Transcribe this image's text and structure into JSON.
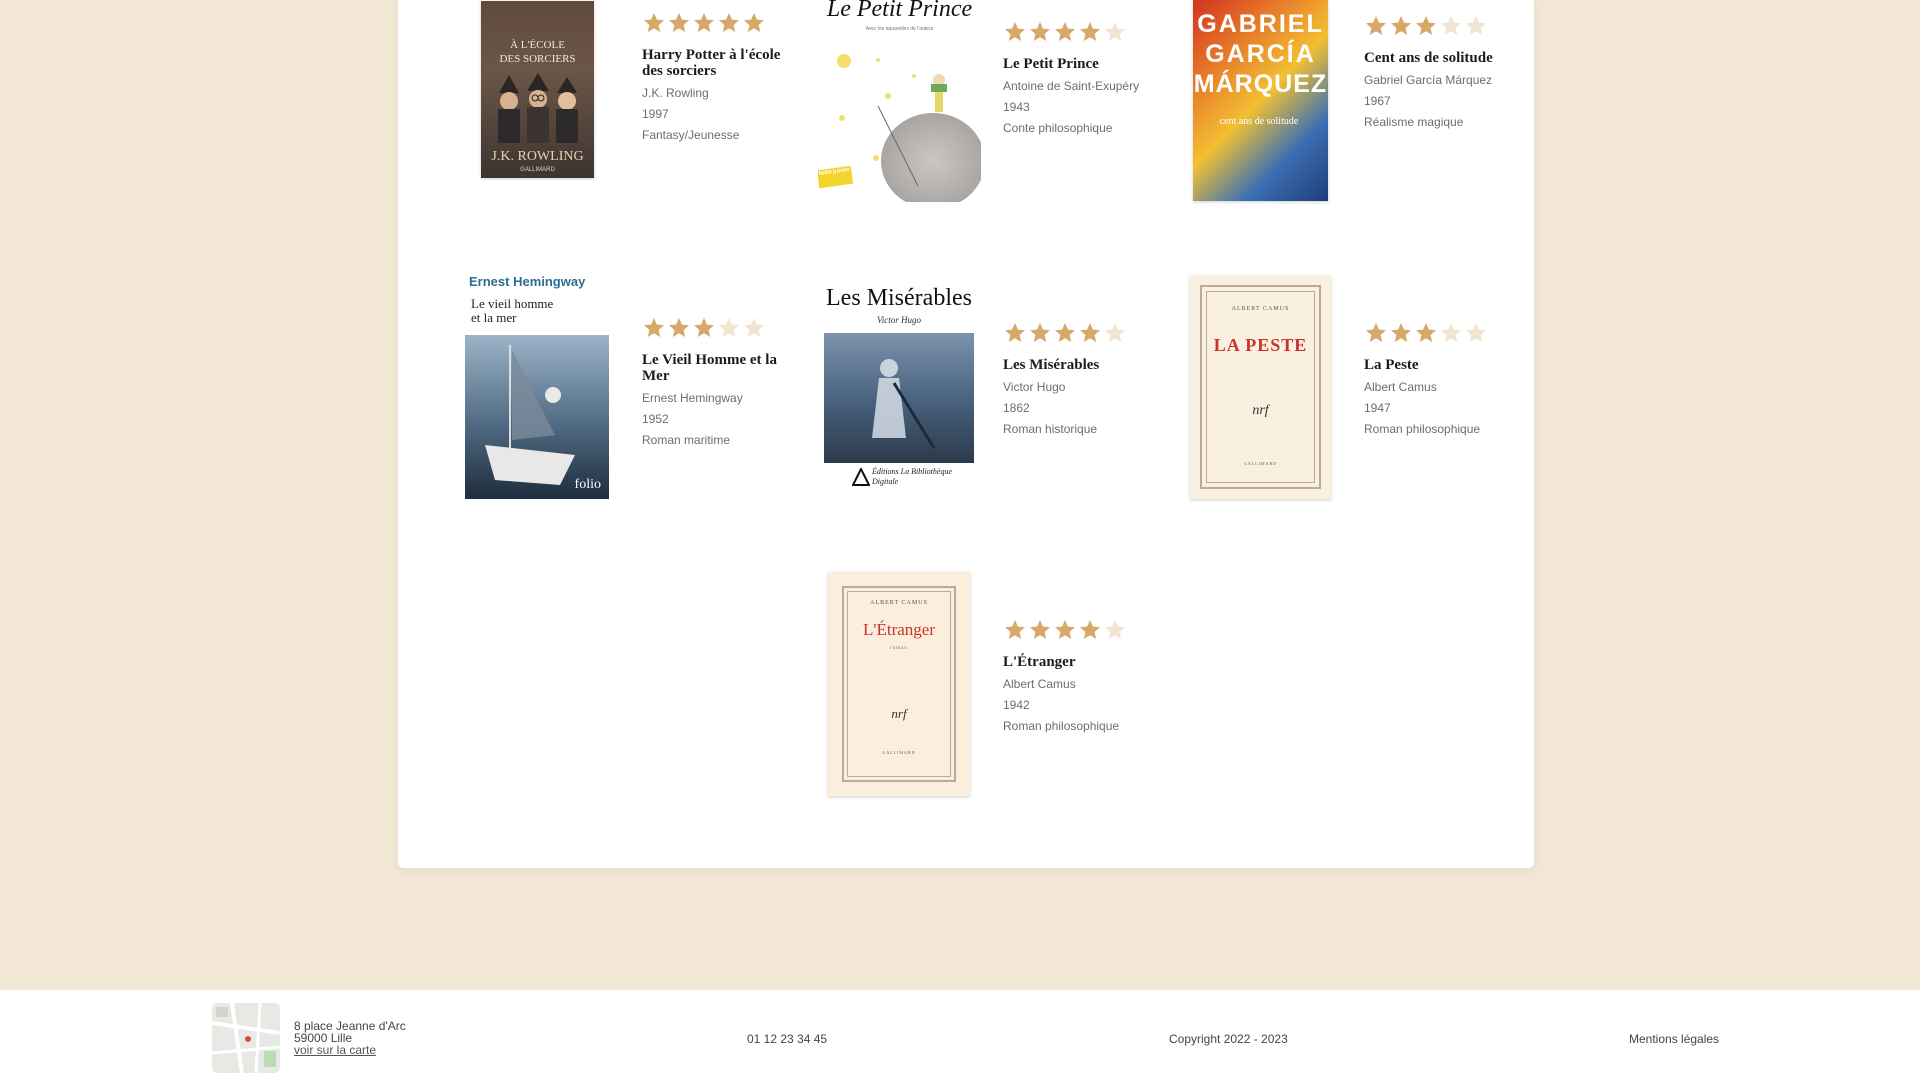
{
  "colors": {
    "star_filled": "#d8a868",
    "star_empty": "#f1e4d0",
    "background": "#f2e6d5"
  },
  "books": [
    {
      "title": "Harry Potter à l'école des sorciers",
      "author": "J.K. Rowling",
      "year": "1997",
      "genre": "Fantasy/Jeunesse",
      "rating": 5,
      "cover": {
        "line1": "À L'ÉCOLE",
        "line2": "DES SORCIERS",
        "author": "J.K. ROWLING",
        "publisher": "GALLIMARD"
      }
    },
    {
      "title": "Le Petit Prince",
      "author": "Antoine de Saint-Exupéry",
      "year": "1943",
      "genre": "Conte philosophique",
      "rating": 4,
      "cover": {
        "line1": "Le Petit Prince",
        "sub": "Avec les aquarelles de l'auteur",
        "badge": "folio junior"
      }
    },
    {
      "title": "Cent ans de solitude",
      "author": "Gabriel García Márquez",
      "year": "1967",
      "genre": "Réalisme magique",
      "rating": 3,
      "cover": {
        "line1": "GABRIEL",
        "line2": "GARCÍA",
        "line3": "MÁRQUEZ",
        "sub": "cent ans de solitude"
      }
    },
    {
      "title": "Le Vieil Homme et la Mer",
      "author": "Ernest Hemingway",
      "year": "1952",
      "genre": "Roman maritime",
      "rating": 3,
      "cover": {
        "author": "Ernest Hemingway",
        "line1": "Le vieil homme",
        "line2": "et la mer",
        "publisher": "folio"
      }
    },
    {
      "title": "Les Misérables",
      "author": "Victor Hugo",
      "year": "1862",
      "genre": "Roman historique",
      "rating": 4,
      "cover": {
        "line1": "Les Misérables",
        "author": "Victor Hugo",
        "publisher": "Éditions La Bibliothèque Digitale"
      }
    },
    {
      "title": "La Peste",
      "author": "Albert Camus",
      "year": "1947",
      "genre": "Roman philosophique",
      "rating": 3,
      "cover": {
        "author": "ALBERT CAMUS",
        "line1": "LA PESTE",
        "logo": "nrf",
        "publisher": "GALLIMARD"
      }
    },
    {
      "title": "L'Étranger",
      "author": "Albert Camus",
      "year": "1942",
      "genre": "Roman philosophique",
      "rating": 4,
      "cover": {
        "author": "ALBERT CAMUS",
        "line1": "L'Étranger",
        "sub": "roman",
        "logo": "nrf",
        "publisher": "GALLIMARD"
      }
    }
  ],
  "footer": {
    "address_line1": "8 place Jeanne d'Arc",
    "address_line2": "59000 Lille",
    "map_link": "voir sur la carte",
    "phone": "01 12 23 34 45",
    "copyright": "Copyright 2022 - 2023",
    "legal": "Mentions légales"
  }
}
